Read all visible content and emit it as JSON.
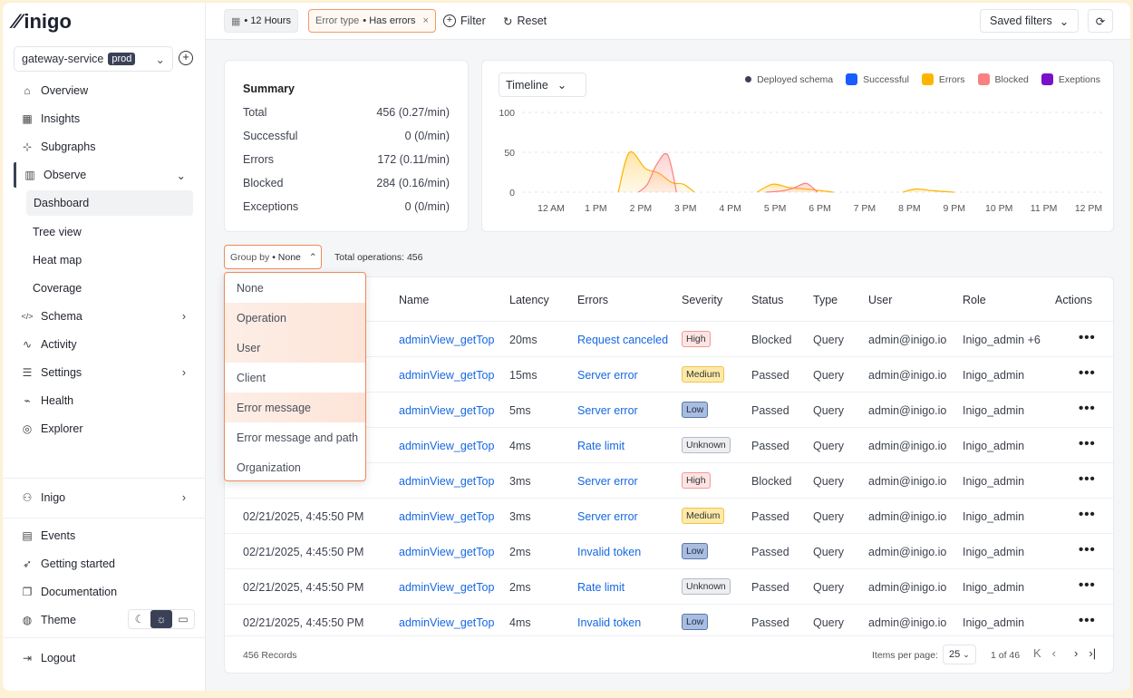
{
  "brand": {
    "logo": "inigo"
  },
  "service": {
    "name": "gateway-service",
    "env": "prod"
  },
  "nav": [
    {
      "label": "Overview",
      "icon": "home-icon"
    },
    {
      "label": "Insights",
      "icon": "grid-icon"
    },
    {
      "label": "Subgraphs",
      "icon": "subgraph-icon"
    },
    {
      "label": "Observe",
      "icon": "bar-chart-icon",
      "expanded": true
    },
    {
      "label": "Dashboard",
      "sub": true,
      "active": true
    },
    {
      "label": "Tree view",
      "sub": true
    },
    {
      "label": "Heat map",
      "sub": true
    },
    {
      "label": "Coverage",
      "sub": true
    },
    {
      "label": "Schema",
      "icon": "code-icon"
    },
    {
      "label": "Activity",
      "icon": "activity-icon"
    },
    {
      "label": "Settings",
      "icon": "sliders-icon"
    },
    {
      "label": "Health",
      "icon": "pulse-icon"
    },
    {
      "label": "Explorer",
      "icon": "gamepad-icon"
    }
  ],
  "bottom_nav": {
    "org": "Inigo",
    "events": "Events",
    "getting_started": "Getting started",
    "documentation": "Documentation",
    "theme": "Theme",
    "logout": "Logout"
  },
  "topbar": {
    "time_range": "• 12 Hours",
    "filter_key": "Error type",
    "filter_value": "• Has errors",
    "filter_btn": "Filter",
    "reset_btn": "Reset",
    "saved_filters": "Saved filters"
  },
  "summary": {
    "title": "Summary",
    "rows": [
      {
        "label": "Total",
        "value": "456 (0.27/min)"
      },
      {
        "label": "Successful",
        "value": "0 (0/min)"
      },
      {
        "label": "Errors",
        "value": "172 (0.11/min)"
      },
      {
        "label": "Blocked",
        "value": "284 (0.16/min)"
      },
      {
        "label": "Exceptions",
        "value": "0 (0/min)"
      }
    ]
  },
  "chart_data": {
    "type": "area",
    "view_select": "Timeline",
    "legend": [
      {
        "name": "Deployed schema",
        "color": "#3a4157",
        "marker": "dot"
      },
      {
        "name": "Successful",
        "color": "#1a5cff"
      },
      {
        "name": "Errors",
        "color": "#ffb400"
      },
      {
        "name": "Blocked",
        "color": "#fb8080"
      },
      {
        "name": "Exeptions",
        "color": "#7a10c9"
      }
    ],
    "yticks": [
      "100",
      "50",
      "0"
    ],
    "ylim": [
      0,
      100
    ],
    "categories": [
      "12 AM",
      "1 PM",
      "2 PM",
      "3 PM",
      "4 PM",
      "5 PM",
      "6 PM",
      "7 PM",
      "8 PM",
      "9 PM",
      "10 PM",
      "11 PM",
      "12 PM"
    ],
    "grid": true,
    "legend_position": "top-right",
    "series": [
      {
        "name": "Errors",
        "color": "#ffb400",
        "points": [
          [
            1.5,
            0
          ],
          [
            1.75,
            50
          ],
          [
            2.1,
            30
          ],
          [
            2.4,
            24
          ],
          [
            2.7,
            12
          ],
          [
            2.95,
            10
          ],
          [
            3.2,
            0
          ],
          [
            4.6,
            0
          ],
          [
            4.95,
            10
          ],
          [
            5.3,
            6
          ],
          [
            5.7,
            4
          ],
          [
            6.0,
            2
          ],
          [
            6.3,
            0
          ],
          [
            7.85,
            0
          ],
          [
            8.15,
            4
          ],
          [
            8.5,
            2
          ],
          [
            9.0,
            0
          ]
        ]
      },
      {
        "name": "Blocked",
        "color": "#fb8080",
        "points": [
          [
            1.95,
            0
          ],
          [
            2.15,
            10
          ],
          [
            2.35,
            34
          ],
          [
            2.6,
            47
          ],
          [
            2.8,
            0
          ],
          [
            4.8,
            0
          ],
          [
            5.2,
            2
          ],
          [
            5.45,
            6
          ],
          [
            5.7,
            11
          ],
          [
            5.95,
            0
          ]
        ]
      }
    ]
  },
  "table_controls": {
    "group_by_label": "Group by",
    "group_by_value": "• None",
    "total_ops": "Total operations: 456"
  },
  "group_options": [
    "None",
    "Operation",
    "User",
    "Client",
    "Error message",
    "Error message and path",
    "Organization"
  ],
  "table": {
    "columns": [
      "Name",
      "Latency",
      "Errors",
      "Severity",
      "Status",
      "Type",
      "User",
      "Role",
      "Actions"
    ],
    "rows": [
      {
        "date": "",
        "name": "adminView_getTop",
        "latency": "20ms",
        "error": "Request canceled",
        "severity": "High",
        "status": "Blocked",
        "type": "Query",
        "user": "admin@inigo.io",
        "role": "Inigo_admin +6"
      },
      {
        "date": "",
        "name": "adminView_getTop",
        "latency": "15ms",
        "error": "Server error",
        "severity": "Medium",
        "status": "Passed",
        "type": "Query",
        "user": "admin@inigo.io",
        "role": "Inigo_admin"
      },
      {
        "date": "",
        "name": "adminView_getTop",
        "latency": "5ms",
        "error": "Server error",
        "severity": "Low",
        "status": "Passed",
        "type": "Query",
        "user": "admin@inigo.io",
        "role": "Inigo_admin"
      },
      {
        "date": "",
        "name": "adminView_getTop",
        "latency": "4ms",
        "error": "Rate limit",
        "severity": "Unknown",
        "status": "Passed",
        "type": "Query",
        "user": "admin@inigo.io",
        "role": "Inigo_admin"
      },
      {
        "date": "",
        "name": "adminView_getTop",
        "latency": "3ms",
        "error": "Server error",
        "severity": "High",
        "status": "Blocked",
        "type": "Query",
        "user": "admin@inigo.io",
        "role": "Inigo_admin"
      },
      {
        "date": "02/21/2025, 4:45:50 PM",
        "name": "adminView_getTop",
        "latency": "3ms",
        "error": "Server error",
        "severity": "Medium",
        "status": "Passed",
        "type": "Query",
        "user": "admin@inigo.io",
        "role": "Inigo_admin"
      },
      {
        "date": "02/21/2025, 4:45:50 PM",
        "name": "adminView_getTop",
        "latency": "2ms",
        "error": "Invalid token",
        "severity": "Low",
        "status": "Passed",
        "type": "Query",
        "user": "admin@inigo.io",
        "role": "Inigo_admin"
      },
      {
        "date": "02/21/2025, 4:45:50 PM",
        "name": "adminView_getTop",
        "latency": "2ms",
        "error": "Rate limit",
        "severity": "Unknown",
        "status": "Passed",
        "type": "Query",
        "user": "admin@inigo.io",
        "role": "Inigo_admin"
      },
      {
        "date": "02/21/2025, 4:45:50 PM",
        "name": "adminView_getTop",
        "latency": "4ms",
        "error": "Invalid token",
        "severity": "Low",
        "status": "Passed",
        "type": "Query",
        "user": "admin@inigo.io",
        "role": "Inigo_admin"
      }
    ]
  },
  "footer": {
    "records": "456 Records",
    "items_per_page_label": "Items per page:",
    "items_per_page": "25",
    "page": "1 of 46"
  }
}
